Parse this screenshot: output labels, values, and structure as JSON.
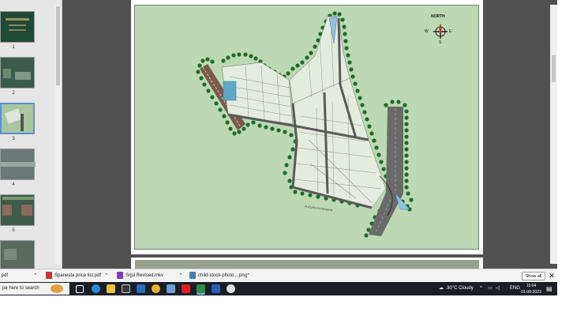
{
  "thumbnails": [
    {
      "num": "1",
      "bg": "#1f4a35"
    },
    {
      "num": "2",
      "bg": "#3c5a4d"
    },
    {
      "num": "3",
      "bg": "#a8c7a0",
      "selected": true
    },
    {
      "num": "4",
      "bg": "#6b7a78"
    },
    {
      "num": "5",
      "bg": "#3e5a4a"
    },
    {
      "num": "",
      "bg": "#5a6a5c"
    }
  ],
  "map": {
    "compass_label": "NORTH",
    "compass_e": "E",
    "compass_w": "W",
    "compass_s": "S",
    "future_label": "FUTURE EXTENSION"
  },
  "downloads": [
    {
      "name": ".pdf",
      "icon_color": "#d32f2f"
    },
    {
      "name": "Spanesta price list.pdf",
      "icon_color": "#d32f2f"
    },
    {
      "name": "Srjpi Revised.mkv",
      "icon_color": "#7a3db8"
    },
    {
      "name": "child-stock-photo....png",
      "icon_color": "#3d7fb8"
    }
  ],
  "download_bar": {
    "show_all": "Show all",
    "close": "✕"
  },
  "taskbar": {
    "search_placeholder": "pe here to search",
    "weather": "30°C  Cloudy",
    "language": "ENG",
    "time": "15:04",
    "date": "01-08-2023"
  },
  "colors": {
    "map_bg": "#bcd9b4",
    "road": "#4a4a4a",
    "tree": "#1f6b2a",
    "viewer_bg": "#515151"
  }
}
